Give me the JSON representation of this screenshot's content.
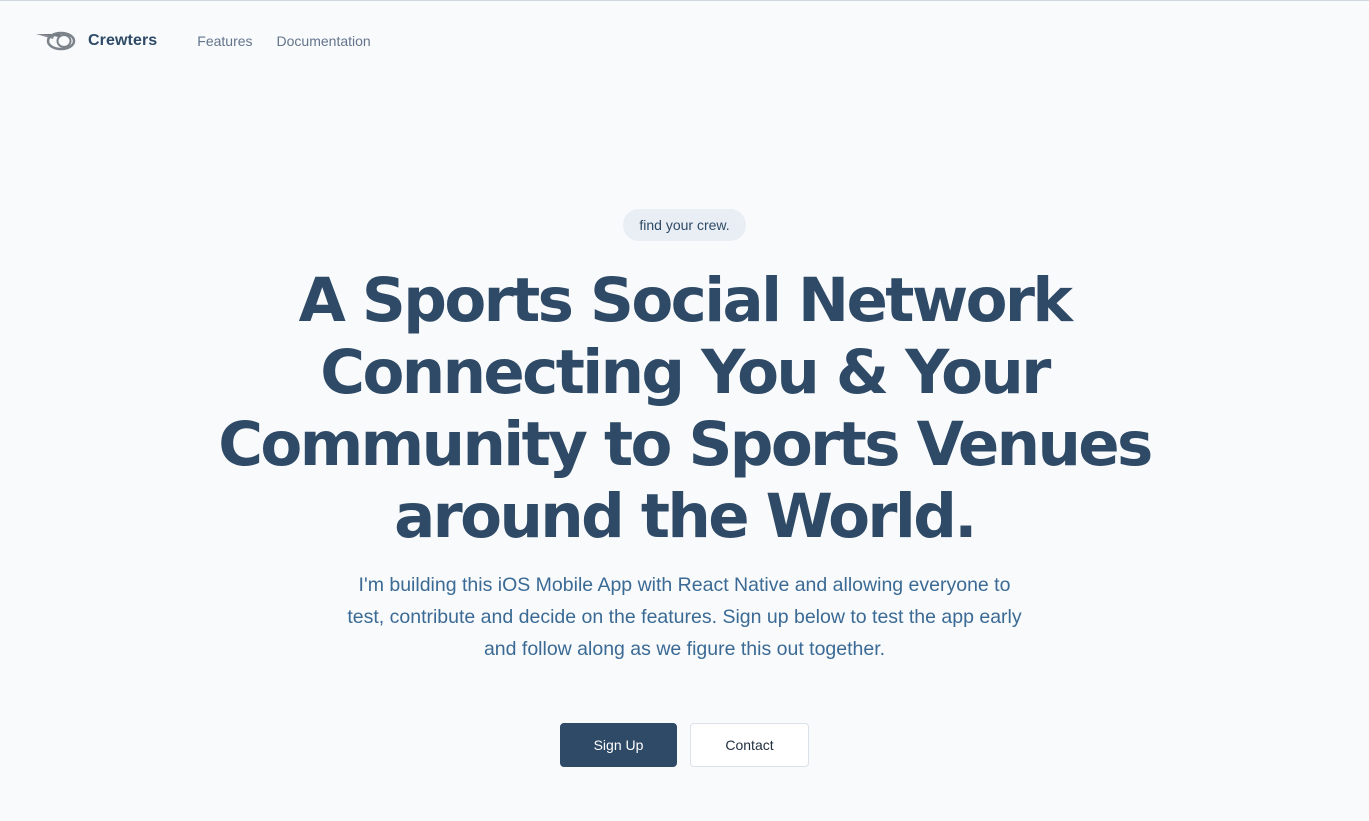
{
  "header": {
    "logo_icon": "goggles-logo-icon",
    "brand_name": "Crewters",
    "nav": [
      {
        "label": "Features"
      },
      {
        "label": "Documentation"
      }
    ]
  },
  "hero": {
    "tagline": "find your crew.",
    "headline": "A Sports Social Network Connecting You & Your Community to Sports Venues around the World.",
    "subtext": "I'm building this iOS Mobile App with React Native and allowing everyone to test, contribute and decide on the features. Sign up below to test the app early and follow along as we figure this out together.",
    "primary_cta": "Sign Up",
    "secondary_cta": "Contact"
  },
  "colors": {
    "background": "#f8fafc",
    "primary": "#2f4a66",
    "subtext": "#3b6a94",
    "nav_text": "#64748b",
    "pill_bg": "#e8eef4"
  }
}
